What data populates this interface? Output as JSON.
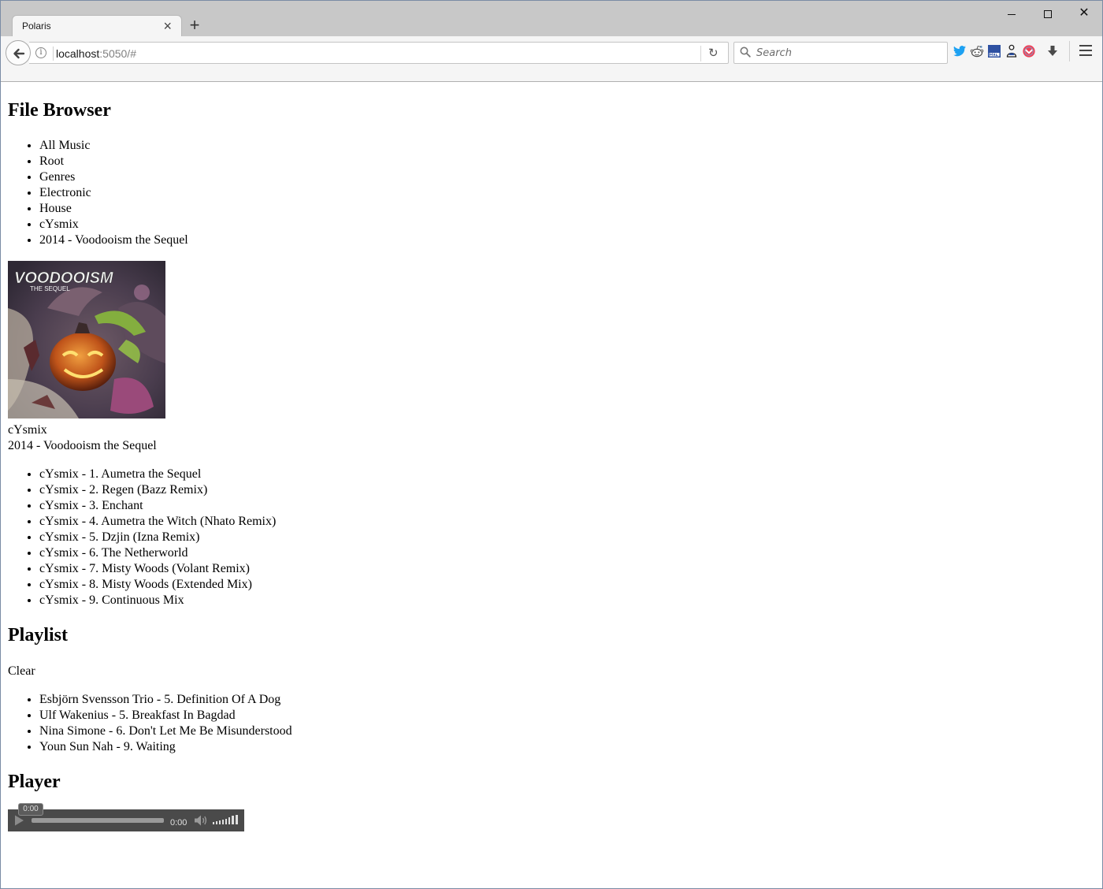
{
  "browser": {
    "tab_title": "Polaris",
    "tab_close": "×",
    "new_tab": "+",
    "window_close": "✕",
    "url_host": "localhost",
    "url_rest": ":5050/#",
    "search_placeholder": "Search",
    "reload_glyph": "↻",
    "info_glyph": "i",
    "extensions": [
      "twitter-icon",
      "reddit-icon",
      "mal-icon",
      "person-icon",
      "pocket-icon"
    ],
    "accent_colors": {
      "twitter": "#1da1f2",
      "reddit": "#5f99cf",
      "mal": "#2e51a2",
      "pocket": "#ef4056"
    }
  },
  "file_browser": {
    "heading": "File Browser",
    "breadcrumbs": [
      "All Music",
      "Root",
      "Genres",
      "Electronic",
      "House",
      "cYsmix",
      "2014 - Voodooism the Sequel"
    ],
    "album": {
      "artist": "cYsmix",
      "title": "2014 - Voodooism the Sequel",
      "cover_text_line1": "VOODOOISM",
      "cover_text_line2": "THE SEQUEL"
    },
    "tracks": [
      "cYsmix - 1. Aumetra the Sequel",
      "cYsmix - 2. Regen (Bazz Remix)",
      "cYsmix - 3. Enchant",
      "cYsmix - 4. Aumetra the Witch (Nhato Remix)",
      "cYsmix - 5. Dzjin (Izna Remix)",
      "cYsmix - 6. The Netherworld",
      "cYsmix - 7. Misty Woods (Volant Remix)",
      "cYsmix - 8. Misty Woods (Extended Mix)",
      "cYsmix - 9. Continuous Mix"
    ]
  },
  "playlist": {
    "heading": "Playlist",
    "clear_label": "Clear",
    "items": [
      "Esbjörn Svensson Trio - 5. Definition Of A Dog",
      "Ulf Wakenius - 5. Breakfast In Bagdad",
      "Nina Simone - 6. Don't Let Me Be Misunderstood",
      "Youn Sun Nah - 9. Waiting"
    ]
  },
  "player": {
    "heading": "Player",
    "bubble_time": "0:00",
    "current_time": "0:00",
    "progress_percent": 0,
    "volume_level": 1.0
  }
}
